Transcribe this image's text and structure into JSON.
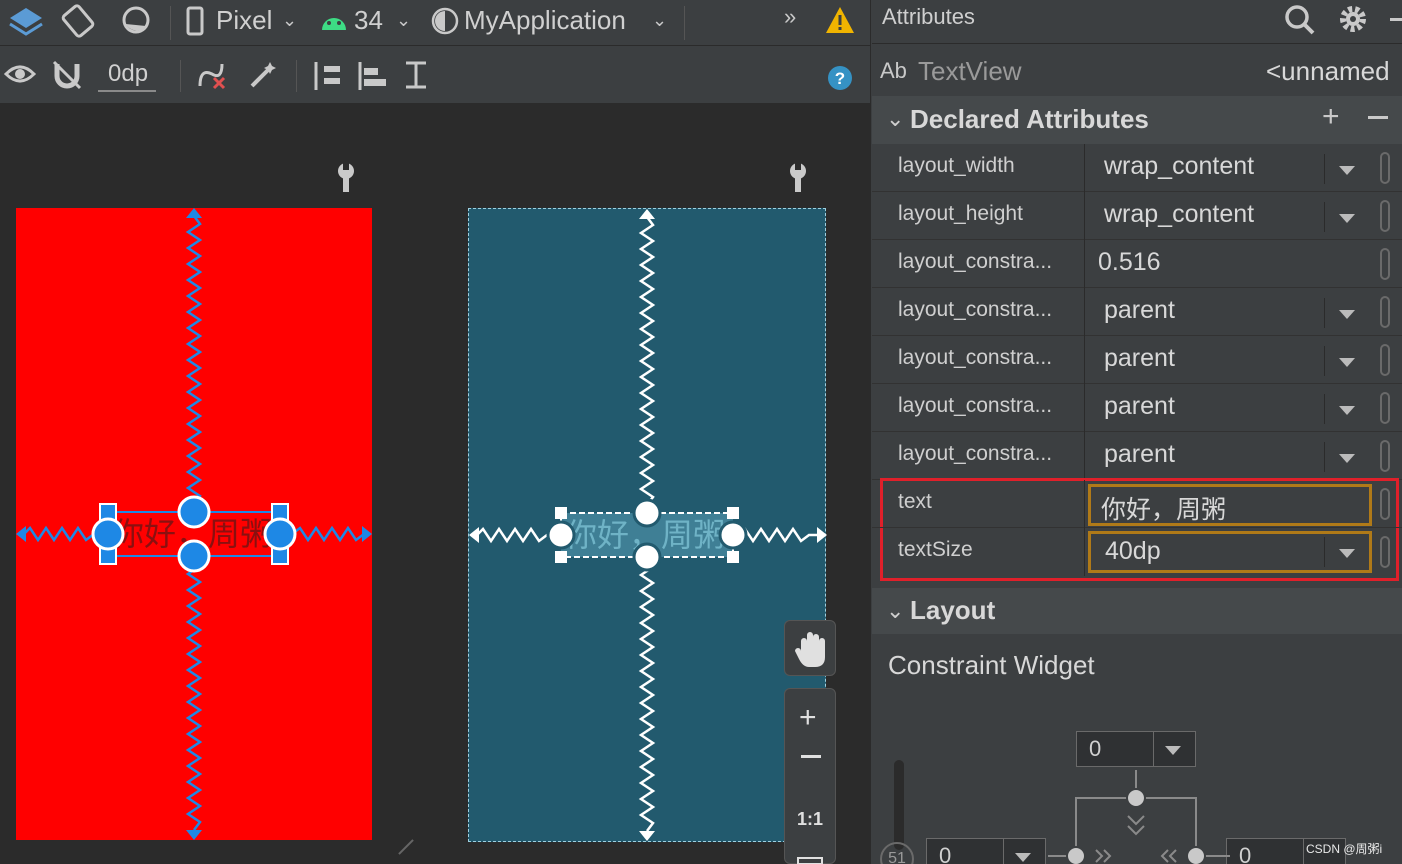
{
  "toolbar": {
    "device": "Pixel",
    "api_level": "34",
    "app_name": "MyApplication",
    "margin_value": "0dp",
    "overflow": "»"
  },
  "panel": {
    "title": "Attributes",
    "component_prefix": "Ab",
    "component_type": "TextView",
    "component_id": "<unnamed",
    "declared_header": "Declared Attributes",
    "layout_header": "Layout",
    "constraint_widget_label": "Constraint Widget"
  },
  "attributes": [
    {
      "name": "layout_width",
      "value": "wrap_content"
    },
    {
      "name": "layout_height",
      "value": "wrap_content"
    },
    {
      "name": "layout_constra...",
      "value": "0.516"
    },
    {
      "name": "layout_constra...",
      "value": "parent"
    },
    {
      "name": "layout_constra...",
      "value": "parent"
    },
    {
      "name": "layout_constra...",
      "value": "parent"
    },
    {
      "name": "layout_constra...",
      "value": "parent"
    },
    {
      "name": "text",
      "value": "你好，周粥"
    },
    {
      "name": "textSize",
      "value": "40dp"
    }
  ],
  "preview": {
    "text_view_text": "你好，周粥"
  },
  "zoom": {
    "ratio_label": "1:1"
  },
  "constraint_widget": {
    "top_margin": "0",
    "left_margin": "0",
    "right_margin": "0",
    "bias": "51"
  },
  "watermark": "CSDN @周粥i",
  "colors": {
    "design_bg": "#ff0000",
    "blueprint_bg": "#225a6e",
    "accent_blue": "#1e88e5",
    "highlight_border": "#e0202a",
    "field_border": "#b07a18",
    "warning": "#f0b400"
  }
}
